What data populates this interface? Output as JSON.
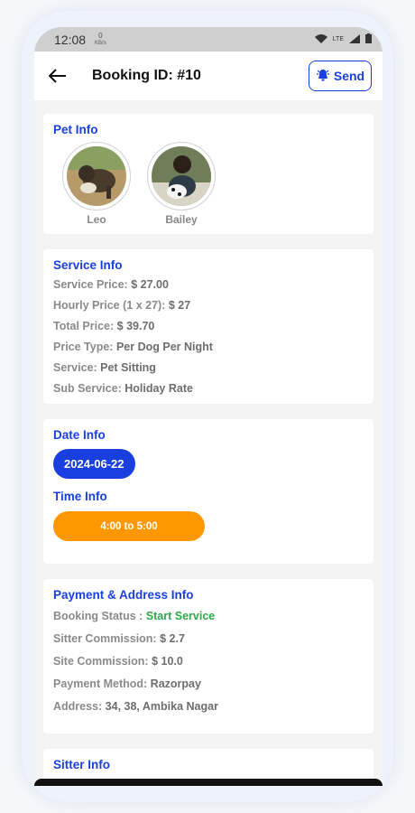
{
  "status_bar": {
    "time": "12:08",
    "net_speed_value": "0",
    "net_speed_unit": "KB/s",
    "carrier": "LTE"
  },
  "header": {
    "title": "Booking ID: #10",
    "send_label": "Send"
  },
  "pet_info": {
    "title": "Pet Info",
    "pets": [
      {
        "name": "Leo"
      },
      {
        "name": "Bailey"
      }
    ]
  },
  "service_info": {
    "title": "Service Info",
    "rows": [
      {
        "label": "Service Price:",
        "value": "$ 27.00"
      },
      {
        "label": "Hourly Price (1 x 27):",
        "value": "$ 27"
      },
      {
        "label": "Total Price:",
        "value": "$ 39.70"
      },
      {
        "label": "Price Type:",
        "value": "Per Dog Per Night"
      },
      {
        "label": "Service:",
        "value": "Pet Sitting"
      },
      {
        "label": "Sub Service:",
        "value": "Holiday Rate"
      }
    ]
  },
  "date_info": {
    "title": "Date Info",
    "date": "2024-06-22",
    "time_title": "Time Info",
    "time": "4:00 to 5:00"
  },
  "payment_info": {
    "title": "Payment & Address Info",
    "rows": [
      {
        "label": "Booking Status :",
        "value": "Start Service"
      },
      {
        "label": "Sitter Commission:",
        "value": "$ 2.7"
      },
      {
        "label": "Site Commission:",
        "value": "$ 10.0"
      },
      {
        "label": "Payment Method:",
        "value": "Razorpay"
      },
      {
        "label": "Address:",
        "value": "34, 38, Ambika Nagar"
      }
    ]
  },
  "sitter_info": {
    "title": "Sitter Info"
  },
  "colors": {
    "accent": "#1a3fe0",
    "time_pill": "#ff9800",
    "status_green": "#2ea84a"
  }
}
